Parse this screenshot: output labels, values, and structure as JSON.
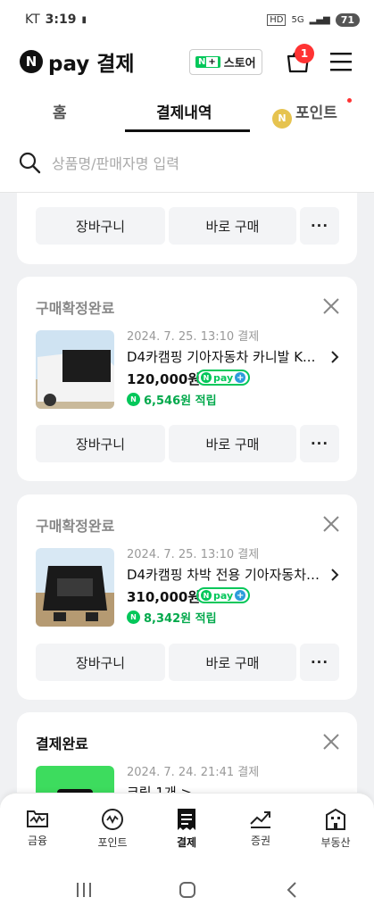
{
  "status_bar": {
    "carrier": "KT",
    "time": "3:19",
    "network": "5G",
    "battery": "71"
  },
  "header": {
    "logo_letter": "N",
    "logo_text": "pay 결제",
    "store_label": "스토어",
    "store_badge": "N",
    "cart_count": "1"
  },
  "tabs": [
    {
      "label": "홈",
      "active": false
    },
    {
      "label": "결제내역",
      "active": true
    },
    {
      "label": "포인트",
      "active": false,
      "has_dot": true
    }
  ],
  "search": {
    "placeholder": "상품명/판매자명 입력"
  },
  "cards": [
    {
      "cart_label": "장바구니",
      "buy_label": "바로 구매",
      "more_label": "···"
    },
    {
      "status": "구매확정완료",
      "date": "2024. 7. 25. 13:10 결제",
      "product": "D4카캠핑 기아자동차 카니발 K...",
      "price": "120,000원",
      "npay_label": "pay",
      "reward": "6,546원 적립",
      "cart_label": "장바구니",
      "buy_label": "바로 구매",
      "more_label": "···"
    },
    {
      "status": "구매확정완료",
      "date": "2024. 7. 25. 13:10 결제",
      "product": "D4카캠핑 차박 전용 기아자동차 ...",
      "price": "310,000원",
      "npay_label": "pay",
      "reward": "8,342원 적립",
      "cart_label": "장바구니",
      "buy_label": "바로 구매",
      "more_label": "···"
    },
    {
      "status": "결제완료",
      "date": "2024. 7. 24. 21:41 결제",
      "product": "크림 1개 >"
    }
  ],
  "bottom_nav": [
    {
      "label": "금융",
      "icon": "finance-icon"
    },
    {
      "label": "포인트",
      "icon": "point-icon"
    },
    {
      "label": "결제",
      "icon": "receipt-icon",
      "active": true
    },
    {
      "label": "증권",
      "icon": "stock-icon"
    },
    {
      "label": "부동산",
      "icon": "building-icon"
    }
  ],
  "colors": {
    "brand_green": "#03c75a",
    "badge_red": "#ff3333",
    "accent_blue": "#2d9cdb"
  }
}
